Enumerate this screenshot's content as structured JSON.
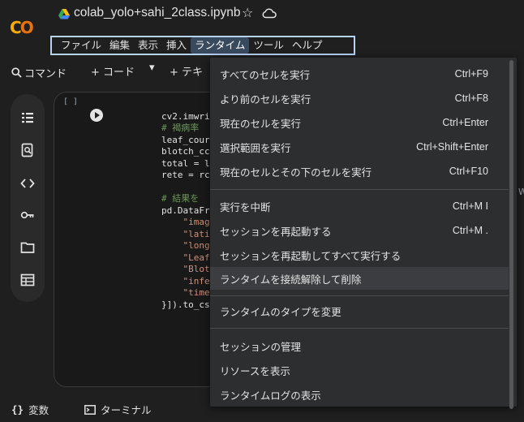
{
  "header": {
    "logo_text": "CO",
    "title": "colab_yolo+sahi_2class.ipynb",
    "star_icon": "star-outline-icon",
    "cloud_icon": "cloud-icon"
  },
  "menubar": {
    "items": [
      "ファイル",
      "編集",
      "表示",
      "挿入",
      "ランタイム",
      "ツール",
      "ヘルプ"
    ],
    "active": "ランタイム"
  },
  "toolbar": {
    "command_label": "コマンド",
    "add_code_label": "+ コード",
    "caret": "▾",
    "add_text_label": "+ テキ"
  },
  "cell": {
    "exec_count": "[ ]",
    "code_lines": [
      "cv2.imwri",
      "",
      "# 褐病率",
      "leaf_cour",
      "blotch_cc",
      "total = l",
      "rete = rc",
      "",
      "# 結果を",
      "pd.DataFr",
      "    \"imag",
      "    \"lati",
      "    \"long",
      "    \"Leaf",
      "    \"Blot",
      "    \"infe",
      "    \"time",
      "}]).to_cs"
    ]
  },
  "bottombar": {
    "variables_label": "変数",
    "terminal_label": "ターミナル"
  },
  "right_edge_text": "W",
  "runtime_menu": {
    "groups": [
      [
        {
          "label": "すべてのセルを実行",
          "shortcut": "Ctrl+F9"
        },
        {
          "label": "より前のセルを実行",
          "shortcut": "Ctrl+F8"
        },
        {
          "label": "現在のセルを実行",
          "shortcut": "Ctrl+Enter"
        },
        {
          "label": "選択範囲を実行",
          "shortcut": "Ctrl+Shift+Enter"
        },
        {
          "label": "現在のセルとその下のセルを実行",
          "shortcut": "Ctrl+F10"
        }
      ],
      [
        {
          "label": "実行を中断",
          "shortcut": "Ctrl+M I"
        },
        {
          "label": "セッションを再起動する",
          "shortcut": "Ctrl+M ."
        },
        {
          "label": "セッションを再起動してすべて実行する",
          "shortcut": ""
        },
        {
          "label": "ランタイムを接続解除して削除",
          "shortcut": ""
        }
      ],
      [
        {
          "label": "ランタイムのタイプを変更",
          "shortcut": ""
        }
      ],
      [
        {
          "label": "セッションの管理",
          "shortcut": ""
        },
        {
          "label": "リソースを表示",
          "shortcut": ""
        },
        {
          "label": "ランタイムログの表示",
          "shortcut": ""
        }
      ]
    ],
    "hovered": "ランタイムを接続解除して削除"
  },
  "colors": {
    "background": "#1f1f1f",
    "menu_bg": "#2d2e30",
    "highlight_border": "#b7d3f7",
    "logo_orange": "#f9ab00"
  }
}
